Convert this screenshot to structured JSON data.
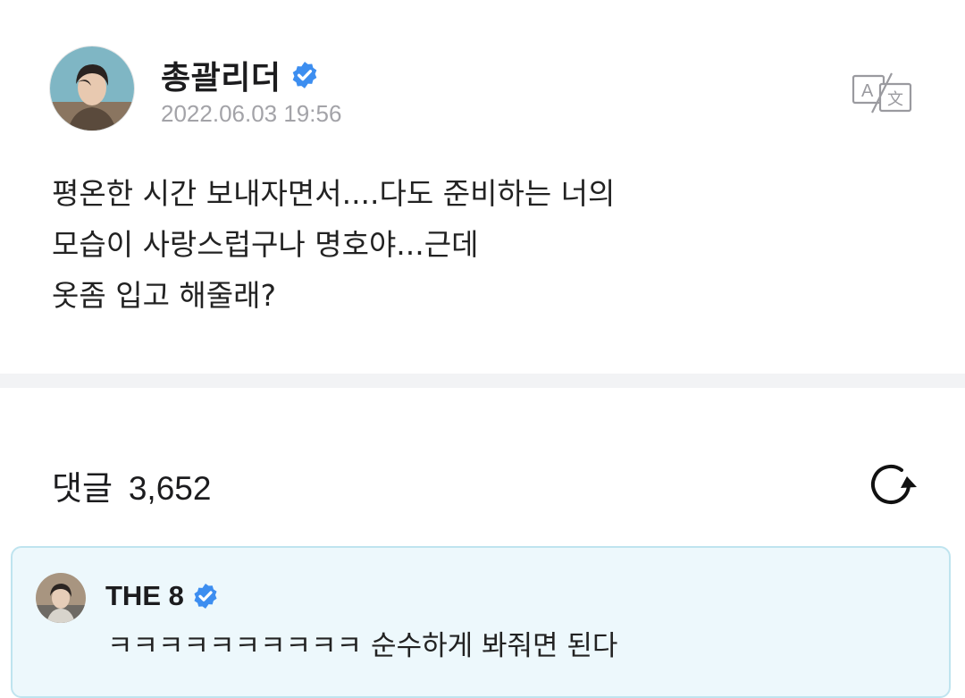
{
  "post": {
    "author": "총괄리더",
    "timestamp": "2022.06.03 19:56",
    "body_lines": [
      "평온한 시간 보내자면서....다도 준비하는 너의",
      "모습이 사랑스럽구나 명호야...근데",
      "옷좀 입고 해줄래?"
    ],
    "avatar_icon": "profile-photo",
    "verified_icon": "verified-badge-icon",
    "translate_icon": "translate-icon"
  },
  "comments": {
    "label": "댓글",
    "count": "3,652",
    "refresh_icon": "refresh-icon",
    "items": [
      {
        "author": "THE 8",
        "text": "ㅋㅋㅋㅋㅋㅋㅋㅋㅋㅋ 순수하게 봐줘면 된다"
      }
    ]
  },
  "colors": {
    "verified": "#3d8ef0",
    "timestamp": "#a3a3a8",
    "comment_bg": "#edf8fc",
    "comment_border": "#bfe4ef",
    "separator": "#f2f3f5"
  }
}
